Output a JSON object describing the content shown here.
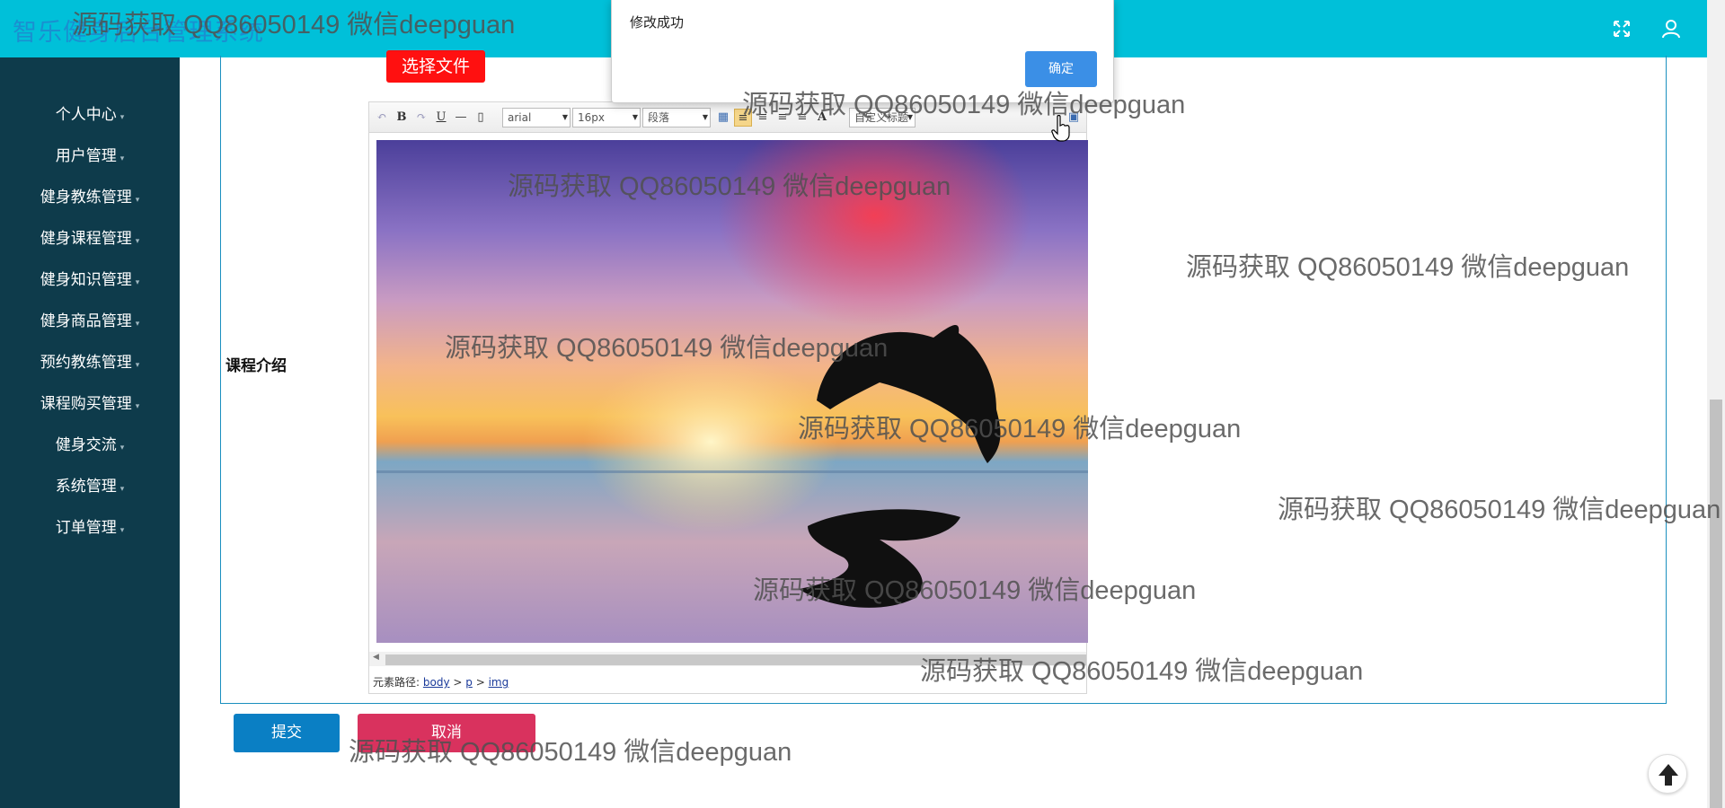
{
  "app": {
    "title": "智乐健身后台管理系统"
  },
  "topbar": {
    "fullscreen_icon": "fullscreen-icon",
    "user_icon": "user-icon"
  },
  "sidebar": {
    "items": [
      {
        "label": "个人中心"
      },
      {
        "label": "用户管理"
      },
      {
        "label": "健身教练管理"
      },
      {
        "label": "健身课程管理"
      },
      {
        "label": "健身知识管理"
      },
      {
        "label": "健身商品管理"
      },
      {
        "label": "预约教练管理"
      },
      {
        "label": "课程购买管理"
      },
      {
        "label": "健身交流"
      },
      {
        "label": "系统管理"
      },
      {
        "label": "订单管理"
      }
    ]
  },
  "form": {
    "choose_file_label": "选择文件",
    "field_label": "课程介绍",
    "submit_label": "提交",
    "cancel_label": "取消"
  },
  "editor": {
    "font_family": "arial",
    "font_size": "16px",
    "paragraph": "段落",
    "custom_title": "自定义标题",
    "element_path_label": "元素路径:",
    "path": [
      "body",
      "p",
      "img"
    ]
  },
  "modal": {
    "message": "修改成功",
    "ok_label": "确定"
  },
  "watermark": {
    "text": "源码获取 QQ86050149 微信deepguan"
  },
  "colors": {
    "topbar": "#00c0d9",
    "sidebar": "#0e3b4b",
    "submit": "#0a7fc4",
    "cancel": "#d9325e",
    "choose_file": "#ff1010",
    "modal_ok": "#3b8fe6"
  }
}
